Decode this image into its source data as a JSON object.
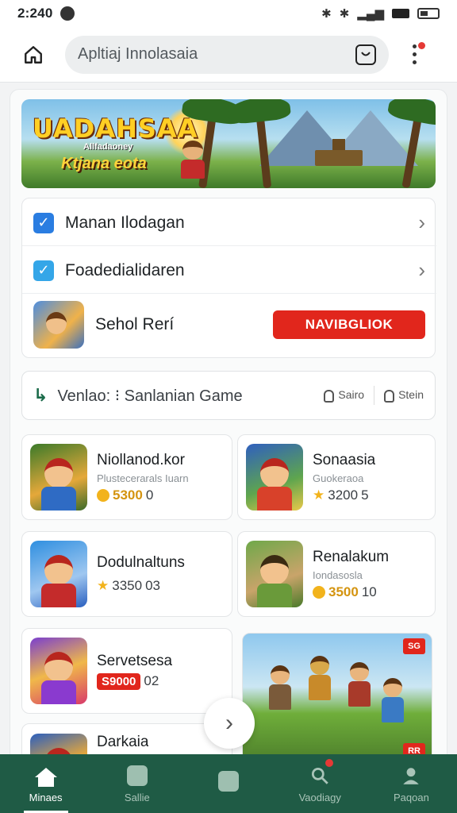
{
  "status_bar": {
    "time": "2:240"
  },
  "top_bar": {
    "url_text": "Apltiaj Innolasaia"
  },
  "banner": {
    "title": "UADAHSAA",
    "subtitle": "Allfadaoney",
    "tagline": "Ktjana eota"
  },
  "settings_list": {
    "items": [
      {
        "label": "Manan Ilodagan"
      },
      {
        "label": "Foadedialidaren"
      }
    ],
    "promo": {
      "label": "Sehol Rerí",
      "button_label": "NAVIBGLIOK"
    }
  },
  "section": {
    "title": "Venlao: ⁝ Sanlanian  Game",
    "action_1": "Sairo",
    "action_2": "Stein"
  },
  "games": [
    {
      "name": "Niollanod.kor",
      "subtitle": "Plustecerarals Iuarn",
      "price": "5300",
      "extra": "0"
    },
    {
      "name": "Sonaasia",
      "subtitle": "Guokeraoa",
      "price": "3200",
      "extra": "5"
    },
    {
      "name": "Dodulnaltuns",
      "subtitle": "",
      "price": "3350",
      "extra": "03"
    },
    {
      "name": "Renalakum",
      "subtitle": "Iondasosla",
      "price": "3500",
      "extra": "10"
    },
    {
      "name": "Servetsesa",
      "subtitle": "",
      "price": "S9000",
      "extra": "02"
    },
    {
      "name": "Darkaia",
      "subtitle": "",
      "price": "",
      "extra": ""
    }
  ],
  "feature": {
    "tag_top": "SG",
    "tag_bottom": "RR"
  },
  "bottom_nav": [
    {
      "label": "Minaes"
    },
    {
      "label": "Sallie"
    },
    {
      "label": ""
    },
    {
      "label": "Vaodiagy"
    },
    {
      "label": "Paqoan"
    }
  ],
  "colors": {
    "accent_red": "#e1261c",
    "nav_green": "#1f5b45",
    "checkbox_blue": "#2a7de1"
  }
}
